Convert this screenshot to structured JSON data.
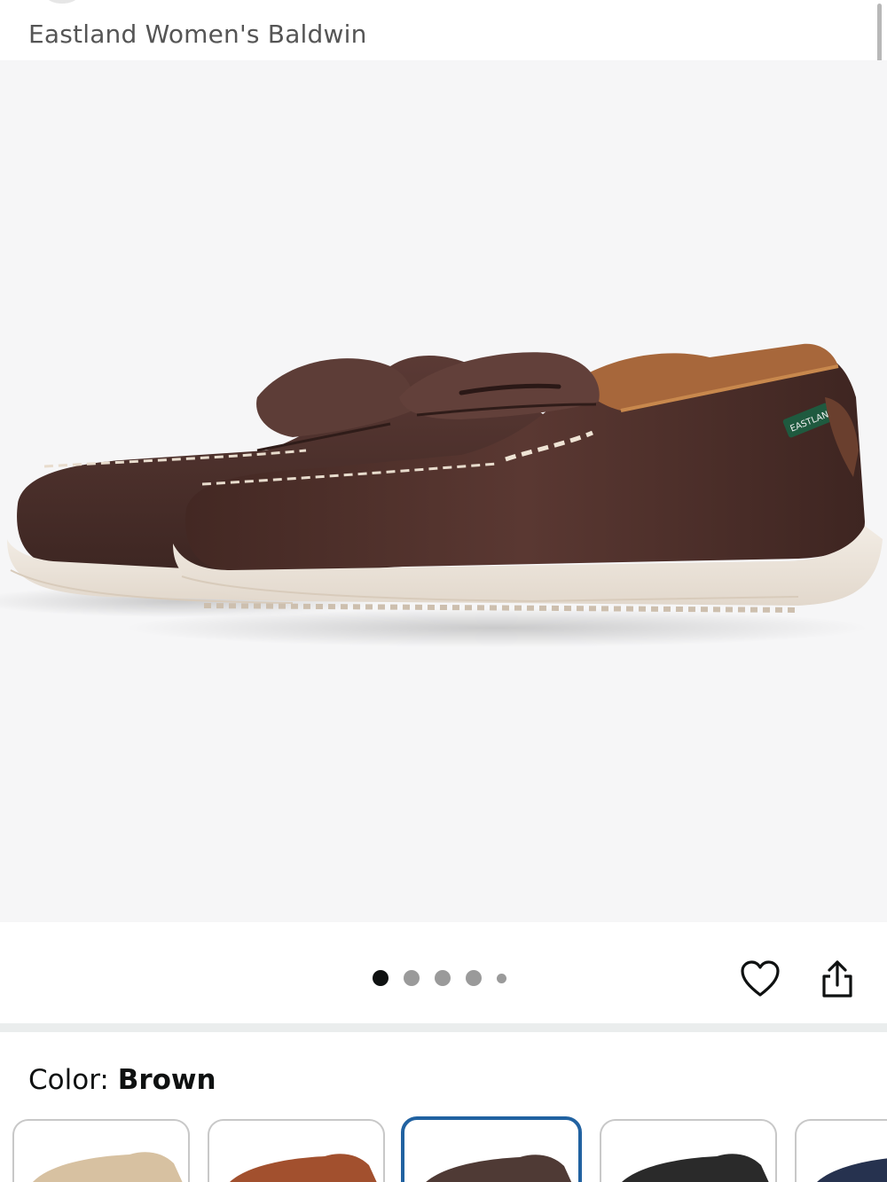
{
  "header": {
    "title": "Eastland Women's Baldwin"
  },
  "gallery": {
    "image_name": "brown-penny-loafers",
    "dots_total": 5,
    "active_index": 0
  },
  "actions": {
    "favorite_icon": "heart-icon",
    "share_icon": "share-icon"
  },
  "color": {
    "label": "Color:",
    "value": "Brown",
    "options": [
      {
        "name": "tan",
        "hex": "#d7c1a1"
      },
      {
        "name": "cognac",
        "hex": "#a2502e"
      },
      {
        "name": "brown",
        "hex": "#4f3a35",
        "selected": true
      },
      {
        "name": "black",
        "hex": "#2a2a2a"
      },
      {
        "name": "navy",
        "hex": "#26324f"
      }
    ]
  },
  "colors": {
    "accent": "#2162a1",
    "text": "#0f1111",
    "gallery_bg": "#f6f6f7",
    "shoe_leather": "#4b2e29"
  }
}
